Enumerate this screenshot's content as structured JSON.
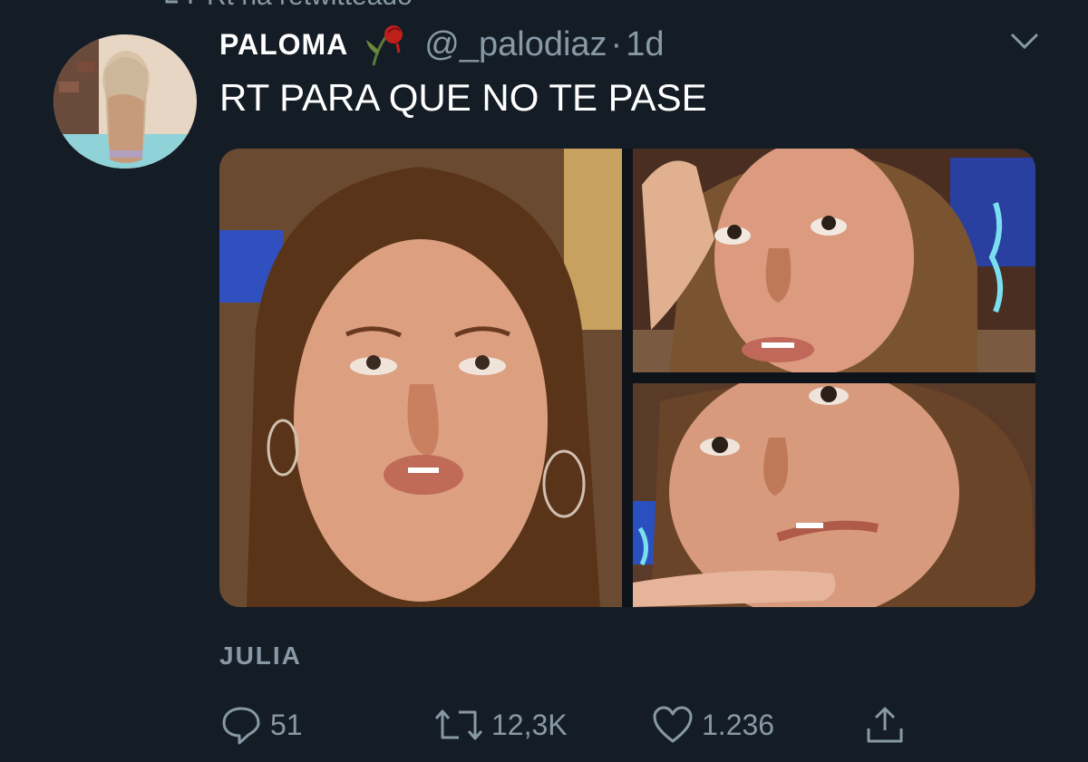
{
  "retweet_banner": {
    "text": "Rt ha retwitteado"
  },
  "tweet": {
    "author_name": "PALOMA",
    "handle": "@_palodiaz",
    "separator": "·",
    "time": "1d",
    "text": "RT PARA QUE NO TE PASE",
    "avatar_icon": "profile-avatar",
    "emoji_icon": "wilted-rose-emoji"
  },
  "quote": {
    "name": "JULIA"
  },
  "actions": {
    "replies": "51",
    "retweets": "12,3K",
    "likes": "1.236"
  },
  "colors": {
    "background": "#141d26",
    "secondary_text": "#8899a6",
    "primary_text": "#ffffff"
  }
}
